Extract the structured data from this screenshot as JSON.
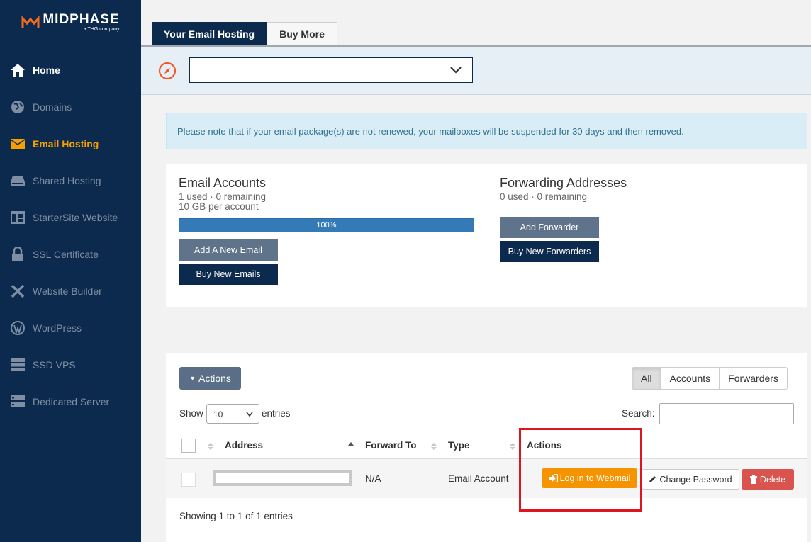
{
  "brand": {
    "name": "MIDPHASE",
    "tagline": "a THG company"
  },
  "sidebar": {
    "items": [
      {
        "label": "Home",
        "icon": "home-icon"
      },
      {
        "label": "Domains",
        "icon": "globe-icon"
      },
      {
        "label": "Email Hosting",
        "icon": "envelope-icon"
      },
      {
        "label": "Shared Hosting",
        "icon": "hdd-icon"
      },
      {
        "label": "StarterSite Website",
        "icon": "layout-icon"
      },
      {
        "label": "SSL Certificate",
        "icon": "lock-icon"
      },
      {
        "label": "Website Builder",
        "icon": "tools-icon"
      },
      {
        "label": "WordPress",
        "icon": "wordpress-icon"
      },
      {
        "label": "SSD VPS",
        "icon": "server-icon"
      },
      {
        "label": "Dedicated Server",
        "icon": "server-stack-icon"
      }
    ]
  },
  "tabs": [
    {
      "label": "Your Email Hosting"
    },
    {
      "label": "Buy More"
    }
  ],
  "domain_select": {
    "value": ""
  },
  "notice": "Please note that if your email package(s) are not renewed, your mailboxes will be suspended for 30 days and then removed.",
  "email_accounts": {
    "title": "Email Accounts",
    "usage": "1 used · 0 remaining",
    "quota": "10 GB per account",
    "progress_percent": 100,
    "progress_label": "100%",
    "add_button": "Add A New Email",
    "buy_button": "Buy New Emails"
  },
  "forwarding": {
    "title": "Forwarding Addresses",
    "usage": "0 used · 0 remaining",
    "add_button": "Add Forwarder",
    "buy_button": "Buy New Forwarders"
  },
  "table": {
    "actions_button": "Actions",
    "filters": [
      "All",
      "Accounts",
      "Forwarders"
    ],
    "show_label": "Show",
    "page_length": "10",
    "entries_label": "entries",
    "search_label": "Search:",
    "columns": [
      "Address",
      "Forward To",
      "Type",
      "Actions"
    ],
    "rows": [
      {
        "address": "",
        "forward_to": "N/A",
        "type": "Email Account"
      }
    ],
    "row_actions": {
      "webmail": "Log in to Webmail",
      "change_password": "Change Password",
      "delete": "Delete"
    },
    "info": "Showing 1 to 1 of 1 entries"
  },
  "colors": {
    "navy": "#0c2a4d",
    "accent_orange": "#f59300",
    "danger": "#d9534f",
    "highlight_box": "#e0141e"
  }
}
